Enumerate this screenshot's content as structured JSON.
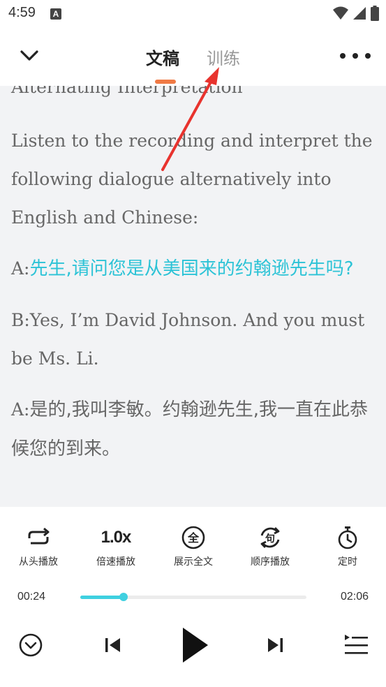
{
  "status_bar": {
    "time": "4:59",
    "notif_letter": "A"
  },
  "header": {
    "tabs": [
      {
        "label": "文稿",
        "active": true
      },
      {
        "label": "训练",
        "active": false
      }
    ],
    "accent_color": "#f07a45"
  },
  "transcript": {
    "partial_heading": "Alternating Interpretation",
    "instruction": "Listen to the recording and interpret the following dialogue alternatively into English and Chinese:",
    "lines": [
      {
        "speaker": "A:",
        "text": "先生,请问您是从美国来的约翰逊先生吗?",
        "highlighted": true
      },
      {
        "speaker": "B:",
        "text": "Yes, I’m David Johnson. And you must be Ms. Li.",
        "highlighted": false
      },
      {
        "speaker": "A:",
        "text": "是的,我叫李敏。约翰逊先生,我一直在此恭候您的到来。",
        "highlighted": false
      }
    ],
    "highlight_color": "#2cc3d6"
  },
  "controls": {
    "buttons": [
      {
        "label": "从头播放",
        "icon": "repeat-icon"
      },
      {
        "label": "倍速播放",
        "icon": "speed-icon",
        "value": "1.0x"
      },
      {
        "label": "展示全文",
        "icon": "full-text-icon",
        "glyph": "全"
      },
      {
        "label": "顺序播放",
        "icon": "sequence-play-icon",
        "glyph": "句"
      },
      {
        "label": "定时",
        "icon": "timer-icon"
      }
    ],
    "current_time": "00:24",
    "total_time": "02:06",
    "progress_fraction": 0.19,
    "progress_color": "#3fd0e0"
  },
  "player": {
    "icons": [
      "collapse-icon",
      "previous-icon",
      "play-icon",
      "next-icon",
      "playlist-icon"
    ]
  }
}
